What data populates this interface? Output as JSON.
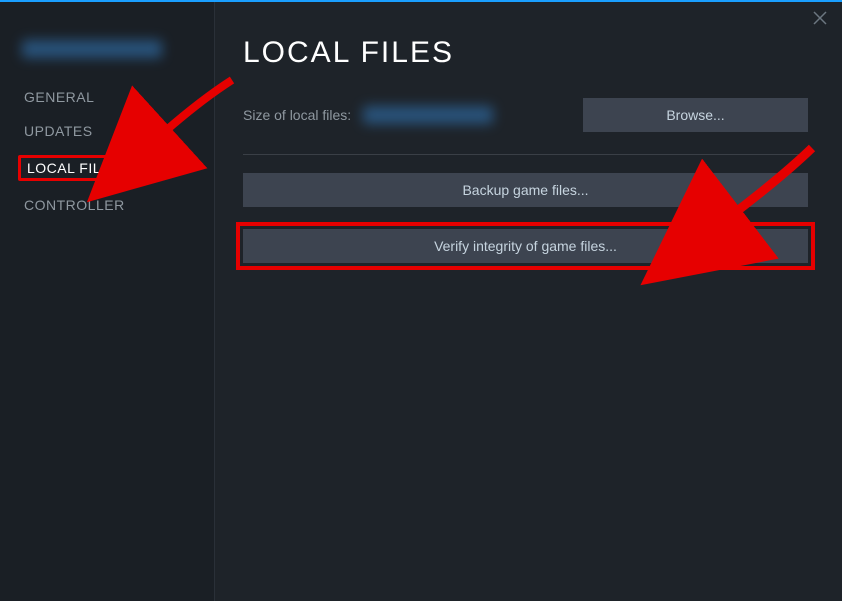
{
  "page_title": "LOCAL FILES",
  "sidebar": {
    "items": [
      {
        "label": "GENERAL"
      },
      {
        "label": "UPDATES"
      },
      {
        "label": "LOCAL FILES"
      },
      {
        "label": "CONTROLLER"
      }
    ]
  },
  "local_files": {
    "size_label": "Size of local files:",
    "browse_label": "Browse...",
    "backup_label": "Backup game files...",
    "verify_label": "Verify integrity of game files..."
  }
}
